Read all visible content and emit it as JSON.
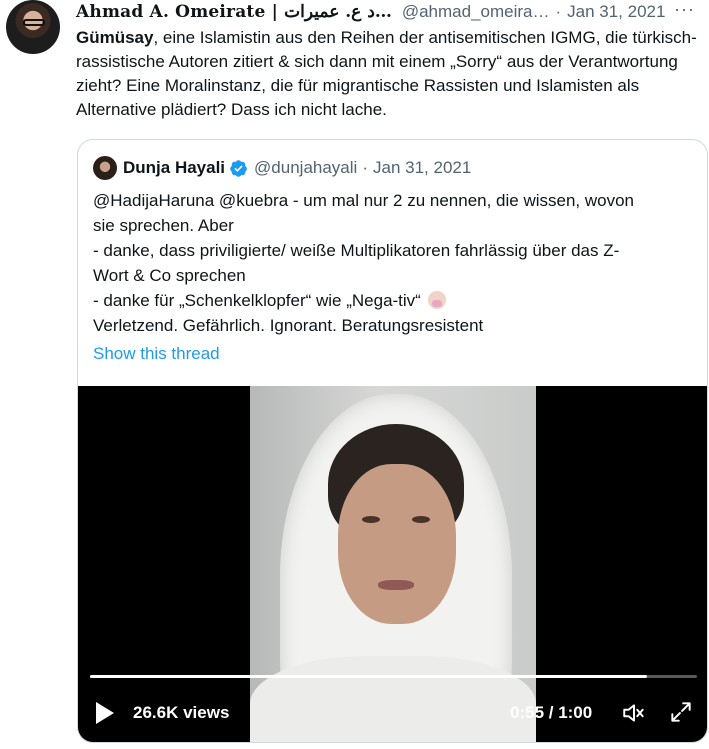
{
  "tweet": {
    "author_name": "Ahmad A. Omeirate | د ع. عميرات…",
    "author_handle": "@ahmad_omeira…",
    "separator": "·",
    "date": "Jan 31, 2021",
    "more": "···",
    "text_bold": "Gümüsay",
    "text_rest": ", eine Islamistin aus den Reihen der antisemitischen IGMG, die türkisch-rassistische Autoren zitiert & sich dann mit einem „Sorry“ aus der Verantwortung zieht? Eine Moralinstanz, die für migrantische Rassisten und Islamisten als Alternative plädiert? Dass ich nicht lache."
  },
  "quote": {
    "author_name": "Dunja Hayali",
    "author_handle": "@dunjahayali",
    "separator": "·",
    "date": "Jan 31, 2021",
    "lines": [
      "@HadijaHaruna @kuebra - um mal nur 2 zu nennen, die wissen, wovon",
      "sie sprechen. Aber",
      "- danke, dass priviligierte/ weiße Multiplikatoren fahrlässig über das Z-",
      "Wort & Co sprechen",
      "- danke für „Schenkelklopfer“ wie „Nega-tiv“",
      "Verletzend. Gefährlich. Ignorant. Beratungsresistent"
    ],
    "emoji": "face-palm-emoji",
    "show_thread": "Show this thread"
  },
  "video": {
    "views": "26.6K views",
    "time": "0:55 / 1:00",
    "progress": 0.917,
    "icons": [
      "play-icon",
      "volume-icon",
      "fullscreen-icon"
    ]
  },
  "colors": {
    "link": "#1d9bf0",
    "secondary_text": "#536471",
    "border": "#cfd9de",
    "verified": "#1d9bf0"
  }
}
